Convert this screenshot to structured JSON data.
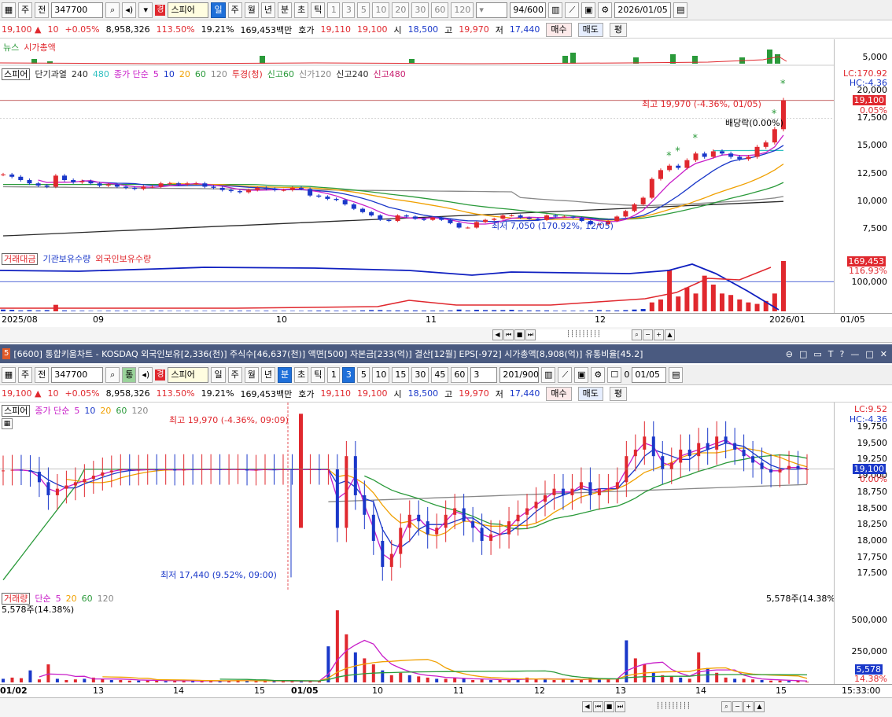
{
  "top": {
    "toolbar": {
      "period": "주",
      "prev": "전",
      "code": "347700",
      "market_tag": "경",
      "name": "스피어",
      "tabs": [
        "일",
        "주",
        "월",
        "년",
        "분",
        "초",
        "틱"
      ],
      "active_tab": "일",
      "minutes": [
        "1",
        "3",
        "5",
        "10",
        "20",
        "30",
        "60",
        "120"
      ],
      "count": "94/600",
      "date": "2026/01/05"
    },
    "quote": {
      "price": "19,100",
      "arrow": "▲",
      "change": "10",
      "rate": "+0.05%",
      "volume": "8,958,326",
      "vol_ratio": "113.50%",
      "turnover": "19.21%",
      "amount": "169,453백만",
      "hoga_label": "호가",
      "ask": "19,110",
      "bid": "19,100",
      "open_label": "시",
      "open": "18,500",
      "high_label": "고",
      "high": "19,970",
      "low_label": "저",
      "low": "17,440",
      "buy": "매수",
      "sell": "매도",
      "eval": "평"
    },
    "news_legend": [
      "뉴스",
      "시가총액"
    ],
    "news_scale": "5,000",
    "price_legend": {
      "name": "스피어",
      "items": [
        "단기과열",
        "240",
        "480",
        "종가 단순",
        "5",
        "10",
        "20",
        "60",
        "120",
        "투경(청)",
        "신고60",
        "신가120",
        "신고240",
        "신고480"
      ]
    },
    "price_axis": {
      "lc": "LC:170.92",
      "hc": "HC:-4.36",
      "labels": [
        "20,000",
        "17,500",
        "15,000",
        "12,500",
        "10,000",
        "7,500"
      ],
      "current_tag": "19,100",
      "current_pct": "0.05%"
    },
    "annotations": {
      "high": "최고 19,970 (-4.36%, 01/05)",
      "low": "최저 7,050 (170.92%, 12/05)",
      "dividend": "배당락(0.00%)"
    },
    "volume_legend": [
      "거래대금",
      "기관보유수량",
      "외국인보유수량"
    ],
    "volume_axis": {
      "value_tag": "169,453",
      "pct": "116.93%",
      "label": "100,000"
    },
    "x_ticks": [
      "2025/08",
      "09",
      "10",
      "11",
      "12",
      "2026/01"
    ],
    "x_right": "01/05"
  },
  "bottom": {
    "title": "[6600] 통합키움차트 - KOSDAQ 외국인보유[2,336(천)] 주식수[46,637(천)] 액면[500] 자본금[233(억)] 결산[12월] EPS[-972] 시가총액[8,908(억)] 유통비율[45.2]",
    "title_icon": "5",
    "window_controls": [
      "⊖",
      "□",
      "▭",
      "T",
      "?",
      "—",
      "□",
      "✕"
    ],
    "toolbar": {
      "period": "주",
      "prev": "전",
      "code": "347700",
      "market_tag": "경",
      "name": "스피어",
      "tabs": [
        "일",
        "주",
        "월",
        "년",
        "분",
        "초",
        "틱"
      ],
      "active_tab": "분",
      "minutes": [
        "1",
        "3",
        "5",
        "10",
        "15",
        "30",
        "45",
        "60"
      ],
      "active_minute": "3",
      "interval": "3",
      "count": "201/900",
      "check_label": "0",
      "date": "01/05"
    },
    "quote": {
      "price": "19,100",
      "arrow": "▲",
      "change": "10",
      "rate": "+0.05%",
      "volume": "8,958,326",
      "vol_ratio": "113.50%",
      "turnover": "19.21%",
      "amount": "169,453백만",
      "hoga_label": "호가",
      "ask": "19,110",
      "bid": "19,100",
      "open_label": "시",
      "open": "18,500",
      "high_label": "고",
      "high": "19,970",
      "low_label": "저",
      "low": "17,440",
      "buy": "매수",
      "sell": "매도",
      "eval": "평"
    },
    "price_legend": {
      "name": "스피어",
      "items": [
        "종가 단순",
        "5",
        "10",
        "20",
        "60",
        "120"
      ]
    },
    "price_axis": {
      "lc": "LC:9.52",
      "hc": "HC:-4.36",
      "labels": [
        "19,750",
        "19,500",
        "19,250",
        "19,000",
        "18,750",
        "18,500",
        "18,250",
        "18,000",
        "17,750",
        "17,500"
      ],
      "current_tag": "19,100",
      "current_pct": "0.00%"
    },
    "annotations": {
      "high": "최고 19,970 (-4.36%, 09:09)",
      "low": "최저 17,440 (9.52%, 09:00)"
    },
    "volume_legend": [
      "거래량",
      "단순",
      "5",
      "20",
      "60",
      "120"
    ],
    "volume_info": "5,578주(14.38%)",
    "volume_axis": {
      "labels": [
        "500,000",
        "250,000"
      ],
      "value_tag": "5,578",
      "pct": "14.38%"
    },
    "x_ticks": [
      "01/02",
      "13",
      "14",
      "15",
      "01/05",
      "10",
      "11",
      "12",
      "13",
      "14",
      "15"
    ],
    "x_right": "15:33:00"
  },
  "colors": {
    "up": "#e0282e",
    "down": "#1a38c9",
    "ma5": "#c81ec8",
    "ma10": "#1a38c9",
    "ma20": "#f0a000",
    "ma60": "#2a9a3a",
    "ma120": "#888888",
    "ma240": "#2a2a2a",
    "ma480": "#30c0c0",
    "title_bg": "#4a5a80",
    "active_tab": "#1e6fd9"
  },
  "chart_data": [
    {
      "type": "candlestick",
      "title": "스피어 일봉",
      "x_range": [
        "2025/08",
        "2026/01/05"
      ],
      "ylim": [
        6000,
        21500
      ],
      "series_ma": [
        "5",
        "10",
        "20",
        "60",
        "120",
        "240",
        "480"
      ],
      "closes": [
        12400,
        12200,
        11900,
        11600,
        11400,
        11300,
        12300,
        11900,
        11700,
        11800,
        11600,
        11400,
        11500,
        11300,
        11200,
        11100,
        11300,
        11300,
        11600,
        11600,
        11500,
        11600,
        11600,
        11300,
        11200,
        11000,
        10900,
        10800,
        11000,
        11200,
        11100,
        11000,
        11000,
        11200,
        11100,
        10500,
        10400,
        10200,
        10100,
        9700,
        9300,
        9000,
        8700,
        8300,
        8200,
        8700,
        8600,
        8400,
        8300,
        8500,
        8300,
        8000,
        7600,
        7600,
        8100,
        8300,
        8400,
        8700,
        8700,
        8500,
        8400,
        8300,
        8700,
        8600,
        8600,
        8500,
        8200,
        7900,
        7900,
        8200,
        8600,
        9100,
        9700,
        10300,
        12000,
        12800,
        13200,
        13000,
        13700,
        14300,
        14000,
        14500,
        14300,
        14000,
        13800,
        14000,
        14900,
        15300,
        16500,
        19100
      ]
    },
    {
      "type": "bar",
      "title": "거래대금",
      "values": [
        6000,
        5000,
        3000,
        4000,
        3000,
        4000,
        22000,
        3000,
        2000,
        2000,
        1500,
        1500,
        2000,
        2000,
        2000,
        1500,
        1200,
        2000,
        2000,
        1500,
        1500,
        1500,
        1500,
        1500,
        1500,
        1500,
        2000,
        2000,
        2000,
        1500,
        2000,
        1500,
        1500,
        1500,
        1500,
        2000,
        2500,
        2500,
        2000,
        2000,
        2000,
        3000,
        4000,
        4000,
        3000,
        3000,
        3000,
        3000,
        2500,
        2500,
        2500,
        3000,
        6000,
        3000,
        5000,
        4000,
        4000,
        4000,
        5000,
        3000,
        3000,
        3000,
        3000,
        2000,
        2000,
        2000,
        2000,
        3000,
        4000,
        3000,
        3000,
        4000,
        6000,
        8000,
        30000,
        40000,
        140000,
        50000,
        80000,
        60000,
        120000,
        90000,
        60000,
        55000,
        40000,
        30000,
        25000,
        35000,
        60000,
        169453
      ]
    },
    {
      "type": "candlestick",
      "title": "스피어 3분봉",
      "x_range": [
        "01/02",
        "01/05 15:33"
      ],
      "ylim": [
        17300,
        20050
      ],
      "closes": [
        19080,
        19090,
        19085,
        19060,
        18900,
        18700,
        18800,
        18850,
        18900,
        18950,
        19000,
        19050,
        19080,
        19100,
        19080,
        19090,
        19100,
        19090,
        19100,
        19080,
        19100,
        19090,
        19100,
        19100,
        19090,
        19100,
        19100,
        19080,
        19090,
        19100,
        19090,
        19100,
        19090,
        19100,
        19100,
        19090,
        19100,
        18200,
        19300,
        18700,
        18400,
        18000,
        17600,
        17800,
        18200,
        18400,
        18300,
        18100,
        18200,
        18400,
        18500,
        18300,
        18200,
        18000,
        18100,
        18100,
        18300,
        18400,
        18500,
        18600,
        18700,
        18800,
        18700,
        18800,
        18900,
        18700,
        18800,
        18800,
        18900,
        19300,
        19400,
        19600,
        19300,
        19100,
        19200,
        19400,
        19300,
        19500,
        19400,
        19600,
        19500,
        19400,
        19300,
        19200,
        19100,
        19050,
        19100,
        19150,
        19100,
        19100
      ]
    },
    {
      "type": "bar",
      "title": "거래량",
      "ylim": [
        0,
        680000
      ],
      "values": [
        30000,
        40000,
        35000,
        100000,
        25000,
        150000,
        30000,
        20000,
        25000,
        30000,
        40000,
        30000,
        20000,
        20000,
        15000,
        15000,
        20000,
        15000,
        10000,
        15000,
        10000,
        15000,
        10000,
        15000,
        10000,
        15000,
        20000,
        10000,
        15000,
        10000,
        10000,
        15000,
        10000,
        10000,
        15000,
        10000,
        300000,
        600000,
        400000,
        250000,
        200000,
        150000,
        100000,
        60000,
        80000,
        60000,
        50000,
        40000,
        30000,
        30000,
        40000,
        30000,
        20000,
        25000,
        20000,
        20000,
        25000,
        30000,
        40000,
        30000,
        25000,
        20000,
        30000,
        20000,
        20000,
        40000,
        30000,
        30000,
        30000,
        350000,
        200000,
        150000,
        80000,
        60000,
        50000,
        40000,
        30000,
        250000,
        120000,
        80000,
        40000,
        30000,
        30000,
        25000,
        20000,
        15000,
        15000,
        12000,
        10000,
        5578
      ]
    }
  ]
}
